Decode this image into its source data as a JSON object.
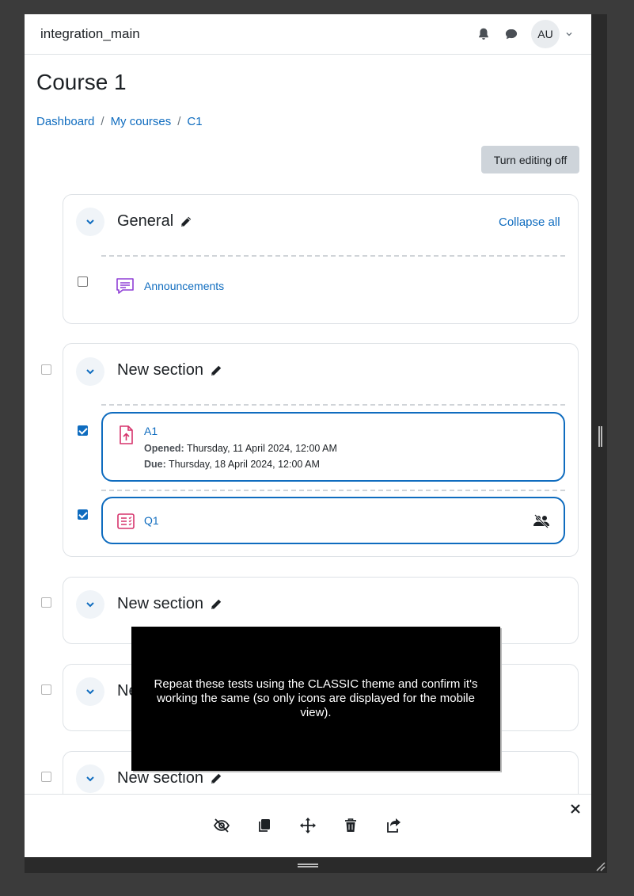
{
  "navbar": {
    "site_name": "integration_main",
    "avatar_initials": "AU"
  },
  "page": {
    "title": "Course 1"
  },
  "breadcrumb": {
    "items": [
      "Dashboard",
      "My courses",
      "C1"
    ],
    "separator": "/"
  },
  "editing": {
    "toggle_label": "Turn editing off"
  },
  "sections": [
    {
      "title": "General",
      "collapse_all_label": "Collapse all"
    },
    {
      "title": "New section"
    },
    {
      "title": "New section"
    },
    {
      "title": "Ne"
    },
    {
      "title": "New section"
    }
  ],
  "activities": {
    "announcements": {
      "name": "Announcements",
      "checked": false
    },
    "a1": {
      "name": "A1",
      "opened_label": "Opened:",
      "opened_value": "Thursday, 11 April 2024, 12:00 AM",
      "due_label": "Due:",
      "due_value": "Thursday, 18 April 2024, 12:00 AM",
      "checked": true
    },
    "q1": {
      "name": "Q1",
      "checked": true
    }
  },
  "tooltip": {
    "text": "Repeat these tests using the CLASSIC theme and confirm it's working the same (so only icons are displayed for the mobile view)."
  },
  "colors": {
    "link": "#0f6cbf",
    "assign_icon": "#d6336c",
    "forum_icon": "#8f3fd6",
    "quiz_icon": "#d6336c"
  },
  "icons": {
    "bulk": [
      "eye-slash-icon",
      "copy-icon",
      "move-icon",
      "trash-icon",
      "share-icon"
    ]
  }
}
